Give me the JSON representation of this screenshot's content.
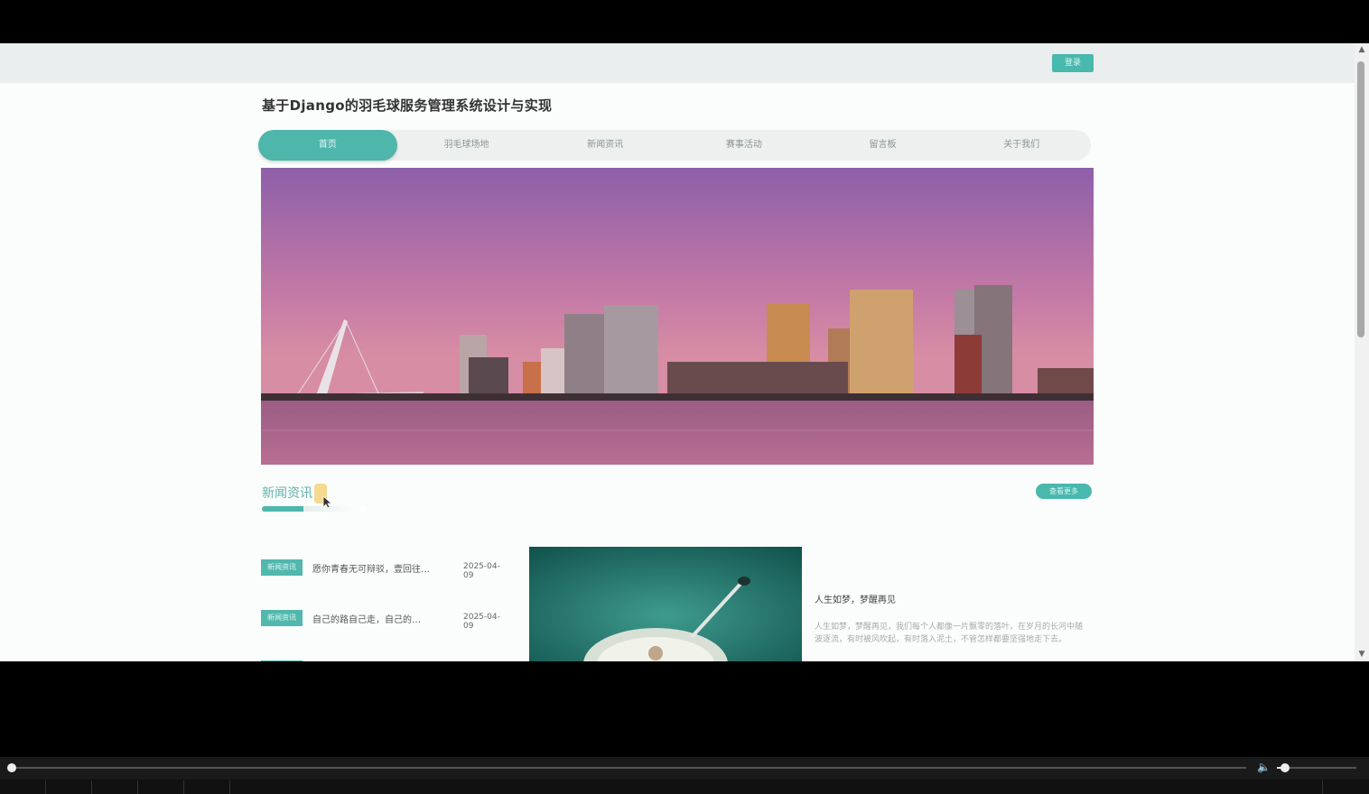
{
  "header": {
    "login_label": "登录"
  },
  "site": {
    "title": "基于Django的羽毛球服务管理系统设计与实现"
  },
  "nav": {
    "items": [
      {
        "label": "首页"
      },
      {
        "label": "羽毛球场地"
      },
      {
        "label": "新闻资讯"
      },
      {
        "label": "赛事活动"
      },
      {
        "label": "留言板"
      },
      {
        "label": "关于我们"
      }
    ]
  },
  "news_section": {
    "title": "新闻资讯",
    "more_label": "查看更多"
  },
  "news_list": [
    {
      "tag": "新闻资讯",
      "text": "愿你青春无可辩驳，壹回往…",
      "date": "2025-04-09"
    },
    {
      "tag": "新闻资讯",
      "text": "自己的路自己走，自己的…",
      "date": "2025-04-09"
    }
  ],
  "feature": {
    "title": "人生如梦，梦醒再见",
    "desc": "人生如梦，梦醒再见，我们每个人都像一片飘零的落叶，在岁月的长河中随波逐流，有时被风吹起，有时落入泥土，不管怎样都要坚强地走下去。"
  },
  "colors": {
    "accent": "#4eb6ab",
    "title": "#333333"
  }
}
